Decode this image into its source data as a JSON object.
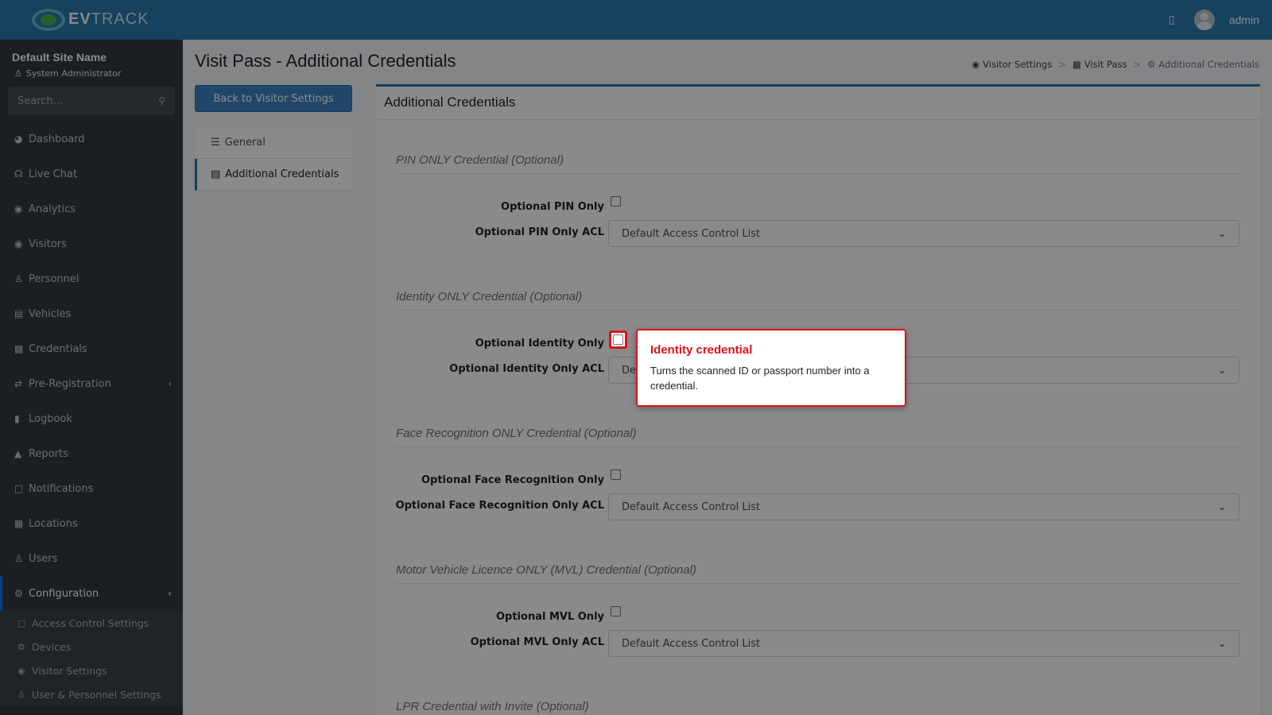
{
  "brand": {
    "logo_text_bold": "EV",
    "logo_text_rest": "TRACK"
  },
  "header": {
    "user": "admin",
    "building_icon": "building-icon"
  },
  "sidebar": {
    "site_name": "Default Site Name",
    "role": "System Administrator",
    "search_placeholder": "Search...",
    "items": [
      {
        "label": "Dashboard"
      },
      {
        "label": "Live Chat"
      },
      {
        "label": "Analytics"
      },
      {
        "label": "Visitors"
      },
      {
        "label": "Personnel"
      },
      {
        "label": "Vehicles"
      },
      {
        "label": "Credentials"
      },
      {
        "label": "Pre-Registration"
      },
      {
        "label": "Logbook"
      },
      {
        "label": "Reports"
      },
      {
        "label": "Notifications"
      },
      {
        "label": "Locations"
      },
      {
        "label": "Users"
      },
      {
        "label": "Configuration"
      }
    ],
    "sub_items": [
      {
        "label": "Access Control Settings"
      },
      {
        "label": "Devices"
      },
      {
        "label": "Visitor Settings"
      },
      {
        "label": "User & Personnel Settings"
      }
    ]
  },
  "page": {
    "title": "Visit Pass - Additional Credentials",
    "breadcrumb": [
      "Visitor Settings",
      "Visit Pass",
      "Additional Credentials"
    ],
    "back_button": "Back to Visitor Settings",
    "left_menu": [
      "General",
      "Additional Credentials"
    ],
    "card_title": "Additional Credentials"
  },
  "sections": [
    {
      "legend": "PIN ONLY Credential (Optional)",
      "check_label": "Optional PIN Only",
      "acl_label": "Optional PIN Only ACL",
      "acl_value": "Default Access Control List"
    },
    {
      "legend": "Identity ONLY Credential (Optional)",
      "check_label": "Optional Identity Only",
      "acl_label": "Optional Identity Only ACL",
      "acl_value": "De"
    },
    {
      "legend": "Face Recognition ONLY Credential (Optional)",
      "check_label": "Optional Face Recognition Only",
      "acl_label": "Optional Face Recognition Only ACL",
      "acl_value": "Default Access Control List"
    },
    {
      "legend": "Motor Vehicle Licence ONLY (MVL) Credential (Optional)",
      "check_label": "Optional MVL Only",
      "acl_label": "Optional MVL Only ACL",
      "acl_value": "Default Access Control List"
    },
    {
      "legend": "LPR Credential with Invite (Optional)"
    }
  ],
  "tooltip": {
    "title": "Identity credential",
    "body": "Turns the scanned ID or passport number into a credential."
  },
  "colors": {
    "accent": "#2a79b0",
    "highlight": "#e0101a",
    "sidebar": "#343a40"
  }
}
